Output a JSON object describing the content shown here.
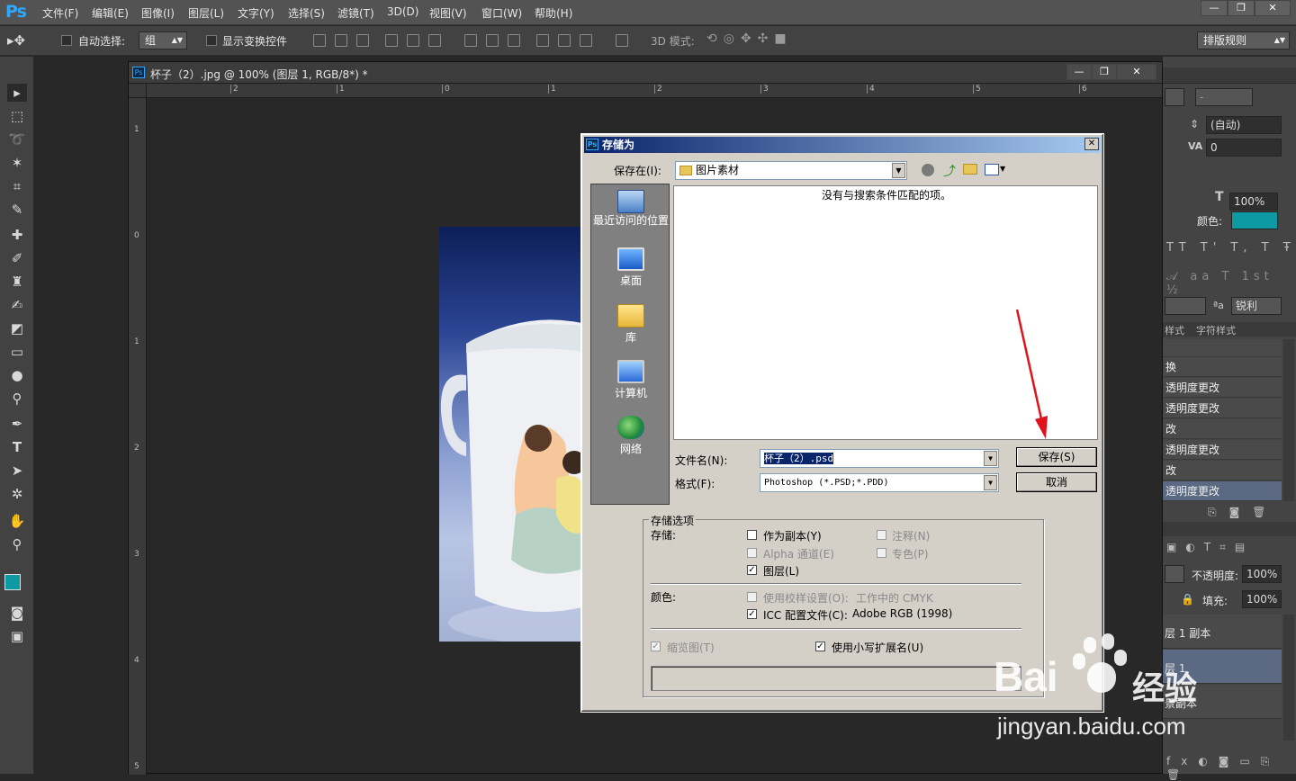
{
  "app": {
    "logo": "Ps",
    "window_controls": [
      "—",
      "❐",
      "✕"
    ]
  },
  "menu": [
    "文件(F)",
    "编辑(E)",
    "图像(I)",
    "图层(L)",
    "文字(Y)",
    "选择(S)",
    "滤镜(T)",
    "3D(D)",
    "视图(V)",
    "窗口(W)",
    "帮助(H)"
  ],
  "options": {
    "auto_select": "自动选择:",
    "auto_select_value": "组",
    "show_transform": "显示变换控件",
    "mode_3d": "3D 模式:",
    "workspace": "排版规则"
  },
  "document": {
    "title": "杯子（2）.jpg @ 100% (图层 1, RGB/8*) *",
    "ruler_h": [
      "2",
      "1",
      "0",
      "1",
      "2",
      "3",
      "4",
      "5",
      "6"
    ],
    "ruler_v": [
      "1",
      "0",
      "1",
      "2",
      "3",
      "4",
      "5"
    ]
  },
  "panels": {
    "auto_leading": "(自动)",
    "tracking": "0",
    "scale": "100%",
    "color_label": "颜色:",
    "color_hex": "#0d9aa3",
    "antialias": "锐利",
    "tabs": [
      "样式",
      "字符样式"
    ],
    "history": [
      "换",
      "透明度更改",
      "透明度更改",
      "改",
      "透明度更改",
      "改",
      "透明度更改"
    ],
    "opacity_label": "不透明度:",
    "opacity": "100%",
    "fill_label": "填充:",
    "fill": "100%",
    "layers": [
      "层 1 副本",
      "层 1",
      "景副本"
    ]
  },
  "dialog": {
    "title": "存储为",
    "save_in_label": "保存在(I):",
    "save_in_value": "图片素材",
    "empty_message": "没有与搜索条件匹配的项。",
    "places": [
      "最近访问的位置",
      "桌面",
      "库",
      "计算机",
      "网络"
    ],
    "filename_label": "文件名(N):",
    "filename_value": "杯子（2）.psd",
    "format_label": "格式(F):",
    "format_value": "Photoshop (*.PSD;*.PDD)",
    "save_button": "保存(S)",
    "cancel_button": "取消",
    "options_group": "存储选项",
    "save_label": "存储:",
    "as_copy": "作为副本(Y)",
    "notes": "注释(N)",
    "alpha": "Alpha 通道(E)",
    "spot": "专色(P)",
    "layers": "图层(L)",
    "color_label": "颜色:",
    "use_proof": "使用校样设置(O):",
    "proof_value": "工作中的 CMYK",
    "icc": "ICC 配置文件(C):",
    "icc_value": "Adobe RGB (1998)",
    "thumbnail": "缩览图(T)",
    "lowercase_ext": "使用小写扩展名(U)"
  },
  "watermark": {
    "brand": "Bai",
    "brand_cn": "经验",
    "url": "jingyan.baidu.com"
  }
}
